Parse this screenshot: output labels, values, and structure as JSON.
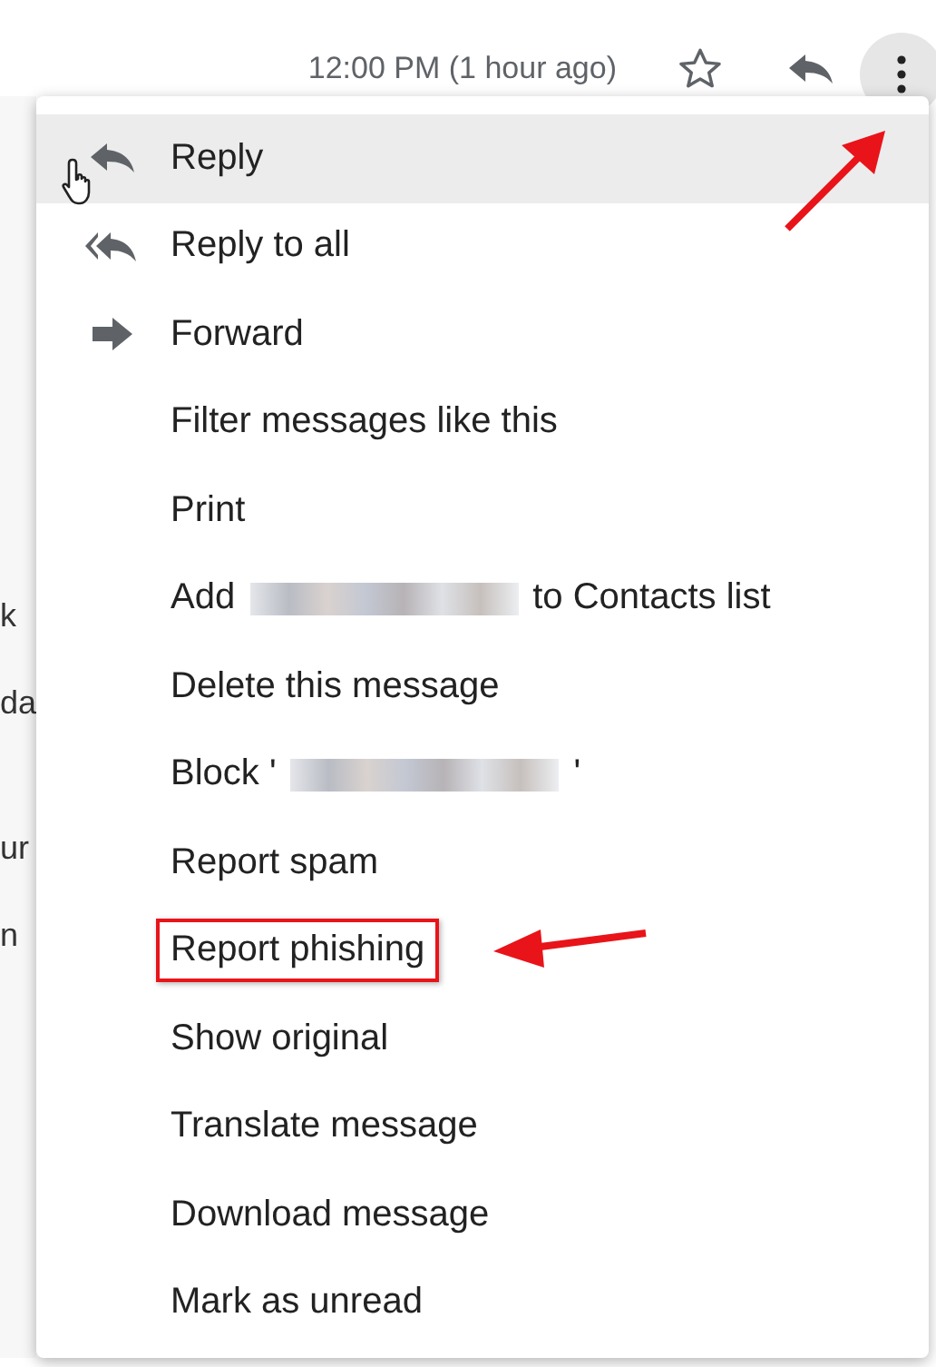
{
  "header": {
    "timestamp": "12:00 PM (1 hour ago)",
    "more_button_pressed": true
  },
  "background_fragments": [
    "k",
    "da",
    "ur",
    "n"
  ],
  "menu": {
    "items": [
      {
        "kind": "reply",
        "selected": true,
        "highlighted": false,
        "parts": [
          {
            "kind": "text",
            "text": "Reply"
          }
        ]
      },
      {
        "kind": "reply-all",
        "selected": false,
        "highlighted": false,
        "parts": [
          {
            "kind": "text",
            "text": "Reply to all"
          }
        ]
      },
      {
        "kind": "forward",
        "selected": false,
        "highlighted": false,
        "parts": [
          {
            "kind": "text",
            "text": "Forward"
          }
        ]
      },
      {
        "kind": "plain",
        "selected": false,
        "highlighted": false,
        "parts": [
          {
            "kind": "text",
            "text": "Filter messages like this"
          }
        ]
      },
      {
        "kind": "plain",
        "selected": false,
        "highlighted": false,
        "parts": [
          {
            "kind": "text",
            "text": "Print"
          }
        ]
      },
      {
        "kind": "plain",
        "selected": false,
        "highlighted": false,
        "parts": [
          {
            "kind": "text",
            "text": "Add"
          },
          {
            "kind": "redacted"
          },
          {
            "kind": "text",
            "text": "to Contacts list"
          }
        ]
      },
      {
        "kind": "plain",
        "selected": false,
        "highlighted": false,
        "parts": [
          {
            "kind": "text",
            "text": "Delete this message"
          }
        ]
      },
      {
        "kind": "plain",
        "selected": false,
        "highlighted": false,
        "parts": [
          {
            "kind": "text",
            "text": "Block '"
          },
          {
            "kind": "redacted"
          },
          {
            "kind": "text",
            "text": "'"
          }
        ]
      },
      {
        "kind": "plain",
        "selected": false,
        "highlighted": false,
        "parts": [
          {
            "kind": "text",
            "text": "Report spam"
          }
        ]
      },
      {
        "kind": "plain",
        "selected": false,
        "highlighted": true,
        "parts": [
          {
            "kind": "text",
            "text": "Report phishing"
          }
        ]
      },
      {
        "kind": "plain",
        "selected": false,
        "highlighted": false,
        "parts": [
          {
            "kind": "text",
            "text": "Show original"
          }
        ]
      },
      {
        "kind": "plain",
        "selected": false,
        "highlighted": false,
        "parts": [
          {
            "kind": "text",
            "text": "Translate message"
          }
        ]
      },
      {
        "kind": "plain",
        "selected": false,
        "highlighted": false,
        "parts": [
          {
            "kind": "text",
            "text": "Download message"
          }
        ]
      },
      {
        "kind": "plain",
        "selected": false,
        "highlighted": false,
        "parts": [
          {
            "kind": "text",
            "text": "Mark as unread"
          }
        ]
      }
    ]
  }
}
